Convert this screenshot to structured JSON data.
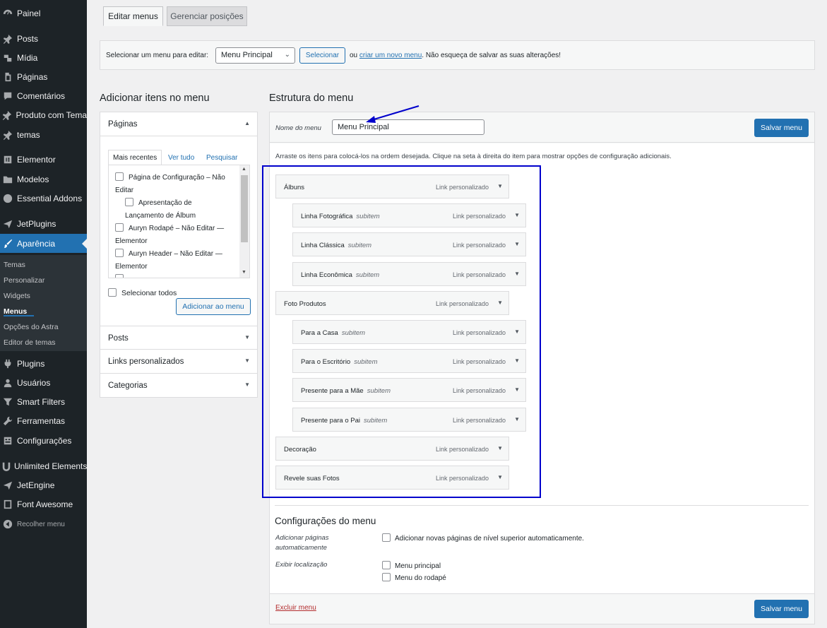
{
  "sidebar": {
    "items": [
      {
        "label": "Painel",
        "icon": "dashboard-icon"
      },
      {
        "label": "Posts",
        "icon": "pin-icon"
      },
      {
        "label": "Mídia",
        "icon": "media-icon"
      },
      {
        "label": "Páginas",
        "icon": "page-icon"
      },
      {
        "label": "Comentários",
        "icon": "comment-icon"
      },
      {
        "label": "Produto com Tema",
        "icon": "pin-icon"
      },
      {
        "label": "temas",
        "icon": "pin-icon"
      },
      {
        "label": "Elementor",
        "icon": "elementor-icon"
      },
      {
        "label": "Modelos",
        "icon": "folder-icon"
      },
      {
        "label": "Essential Addons",
        "icon": "ea-icon"
      },
      {
        "label": "JetPlugins",
        "icon": "jet-icon"
      },
      {
        "label": "Aparência",
        "icon": "brush-icon"
      }
    ],
    "submenu": [
      "Temas",
      "Personalizar",
      "Widgets",
      "Menus",
      "Opções do Astra",
      "Editor de temas"
    ],
    "items_bottom": [
      {
        "label": "Plugins",
        "icon": "plugin-icon"
      },
      {
        "label": "Usuários",
        "icon": "users-icon"
      },
      {
        "label": "Smart Filters",
        "icon": "filter-icon"
      },
      {
        "label": "Ferramentas",
        "icon": "wrench-icon"
      },
      {
        "label": "Configurações",
        "icon": "settings-icon"
      },
      {
        "label": "Unlimited Elements",
        "icon": "ue-icon"
      },
      {
        "label": "JetEngine",
        "icon": "jet-icon"
      },
      {
        "label": "Font Awesome",
        "icon": "flag-icon"
      }
    ],
    "collapse": "Recolher menu"
  },
  "tabs": {
    "edit": "Editar menus",
    "manage": "Gerenciar posições"
  },
  "select_bar": {
    "label": "Selecionar um menu para editar:",
    "selected": "Menu Principal",
    "button": "Selecionar",
    "or": "ou",
    "create_link": "criar um novo menu",
    "reminder": ". Não esqueça de salvar as suas alterações!"
  },
  "left": {
    "heading": "Adicionar itens no menu",
    "pages_title": "Páginas",
    "tabs": [
      "Mais recentes",
      "Ver tudo",
      "Pesquisar"
    ],
    "pages": [
      "Página de Configuração – Não",
      "Editar",
      "Apresentação de",
      "Lançamento de Álbum",
      "Auryn Rodapé – Não Editar —",
      "Elementor",
      "Auryn Header – Não Editar —",
      "Elementor"
    ],
    "select_all": "Selecionar todos",
    "add_button": "Adicionar ao menu",
    "sections": [
      "Posts",
      "Links personalizados",
      "Categorias"
    ]
  },
  "right": {
    "heading": "Estrutura do menu",
    "name_label": "Nome do menu",
    "name_value": "Menu Principal",
    "save": "Salvar menu",
    "instructions": "Arraste os itens para colocá-los na ordem desejada. Clique na seta à direita do item para mostrar opções de configuração adicionais.",
    "items": [
      {
        "title": "Álbuns",
        "type": "Link personalizado",
        "level": 0
      },
      {
        "title": "Linha Fotográfica",
        "sub": "subitem",
        "type": "Link personalizado",
        "level": 1
      },
      {
        "title": "Linha Clássica",
        "sub": "subitem",
        "type": "Link personalizado",
        "level": 1
      },
      {
        "title": "Linha Econômica",
        "sub": "subitem",
        "type": "Link personalizado",
        "level": 1
      },
      {
        "title": "Foto Produtos",
        "type": "Link personalizado",
        "level": 0
      },
      {
        "title": "Para a Casa",
        "sub": "subitem",
        "type": "Link personalizado",
        "level": 1
      },
      {
        "title": "Para o Escritório",
        "sub": "subitem",
        "type": "Link personalizado",
        "level": 1
      },
      {
        "title": "Presente para a Mãe",
        "sub": "subitem",
        "type": "Link personalizado",
        "level": 1
      },
      {
        "title": "Presente para o Pai",
        "sub": "subitem",
        "type": "Link personalizado",
        "level": 1
      },
      {
        "title": "Decoração",
        "type": "Link personalizado",
        "level": 0
      },
      {
        "title": "Revele suas Fotos",
        "type": "Link personalizado",
        "level": 0
      }
    ],
    "settings_title": "Configurações do menu",
    "auto_add_label": "Adicionar páginas automaticamente",
    "auto_add_option": "Adicionar novas páginas de nível superior automaticamente.",
    "location_label": "Exibir localização",
    "locations": [
      "Menu principal",
      "Menu do rodapé"
    ],
    "delete": "Excluir menu"
  },
  "colors": {
    "accent": "#2271b1",
    "highlight_box": "#0000cc",
    "sidebar": "#1d2327"
  }
}
